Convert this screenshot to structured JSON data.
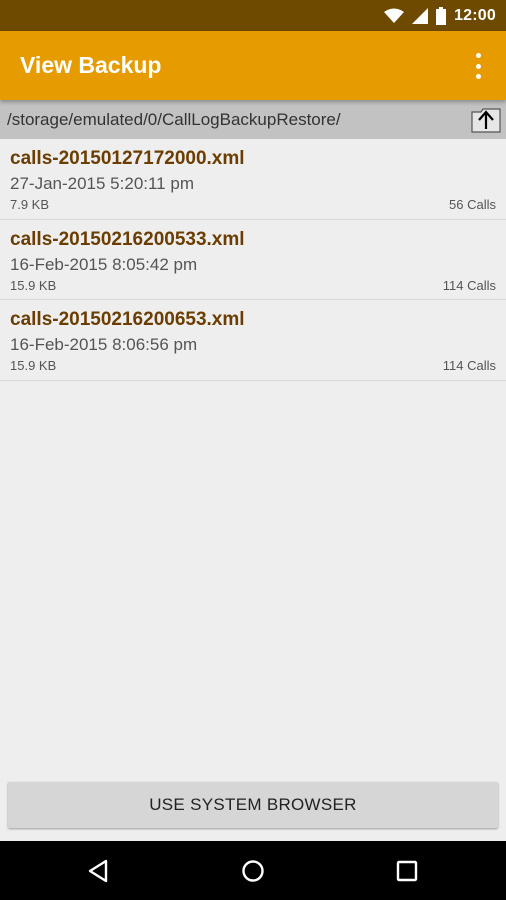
{
  "status_bar": {
    "time": "12:00",
    "icons": [
      "wifi-icon",
      "cell-signal-icon",
      "battery-icon"
    ]
  },
  "app_bar": {
    "title": "View Backup",
    "overflow_icon": "more-vert-icon"
  },
  "path_bar": {
    "path": "/storage/emulated/0/CallLogBackupRestore/",
    "up_icon": "folder-up-icon"
  },
  "files": [
    {
      "name": "calls-20150127172000.xml",
      "date": "27-Jan-2015 5:20:11 pm",
      "size": "7.9 KB",
      "count": "56 Calls"
    },
    {
      "name": "calls-20150216200533.xml",
      "date": "16-Feb-2015 8:05:42 pm",
      "size": "15.9 KB",
      "count": "114 Calls"
    },
    {
      "name": "calls-20150216200653.xml",
      "date": "16-Feb-2015 8:06:56 pm",
      "size": "15.9 KB",
      "count": "114 Calls"
    }
  ],
  "actions": {
    "system_browser_label": "USE SYSTEM BROWSER"
  },
  "nav_bar": {
    "icons": [
      "back-icon",
      "home-icon",
      "recents-icon"
    ]
  },
  "colors": {
    "status_bar": "#6e4a00",
    "app_bar": "#e69c00",
    "file_name": "#6b3d00"
  }
}
